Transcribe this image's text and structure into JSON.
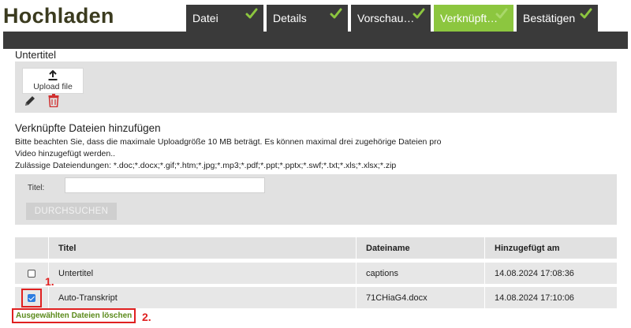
{
  "page": {
    "title": "Hochladen"
  },
  "tabs": [
    {
      "label": "Datei",
      "width": 98
    },
    {
      "label": "Details",
      "width": 103
    },
    {
      "label": "Vorschau…",
      "width": 101
    },
    {
      "label": "Verknüpft…",
      "width": 101
    },
    {
      "label": "Bestätigen",
      "width": 103
    }
  ],
  "colors": {
    "active_tab": "#8cc63f",
    "tab": "#3a3a3a",
    "check": "#8cc63f",
    "annotation": "#e02020"
  },
  "subtitle_section": {
    "label": "Untertitel",
    "upload_button": "Upload file"
  },
  "linked_files": {
    "heading": "Verknüpfte Dateien hinzufügen",
    "info_line1": "Bitte beachten Sie, dass die maximale Uploadgröße 10 MB beträgt. Es können maximal drei zugehörige Dateien pro",
    "info_line2": "Video hinzugefügt werden..",
    "info_line3": "Zulässige Dateiendungen: *.doc;*.docx;*.gif;*.htm;*.jpg;*.mp3;*.pdf;*.ppt;*.pptx;*.swf;*.txt;*.xls;*.xlsx;*.zip"
  },
  "search": {
    "label": "Titel:",
    "value": "",
    "browse_button": "DURCHSUCHEN"
  },
  "table": {
    "columns": [
      "Titel",
      "Dateiname",
      "Hinzugefügt am"
    ],
    "rows": [
      {
        "checked": false,
        "title": "Untertitel",
        "filename": "captions",
        "date": "14.08.2024 17:08:36"
      },
      {
        "checked": true,
        "title": "Auto-Transkript",
        "filename": "71CHiaG4.docx",
        "date": "14.08.2024 17:10:06"
      }
    ]
  },
  "delete_link": "Ausgewählten Dateien löschen",
  "annotations": {
    "step1": "1.",
    "step2": "2."
  },
  "icons": {
    "check": "check-icon",
    "upload": "upload-icon",
    "edit": "pencil-icon",
    "delete": "trash-icon"
  }
}
